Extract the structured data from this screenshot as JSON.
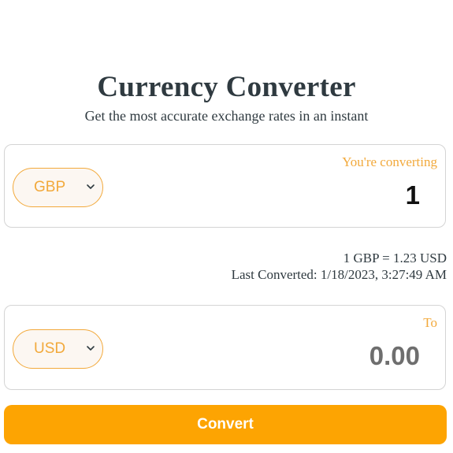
{
  "header": {
    "title": "Currency Converter",
    "subtitle": "Get the most accurate exchange rates in an instant"
  },
  "from": {
    "currency": "GBP",
    "label": "You're converting",
    "amount": "1"
  },
  "rate": {
    "summary": "1 GBP = 1.23 USD",
    "last_converted": "Last Converted: 1/18/2023, 3:27:49 AM"
  },
  "to": {
    "currency": "USD",
    "label": "To",
    "amount": "0.00"
  },
  "actions": {
    "convert_label": "Convert"
  },
  "icons": {
    "select_chevron": "chevron-down-icon"
  },
  "colors": {
    "accent": "#f2a93b",
    "button": "#fda402",
    "text": "#2f3a40",
    "border": "#d4d4d4"
  }
}
